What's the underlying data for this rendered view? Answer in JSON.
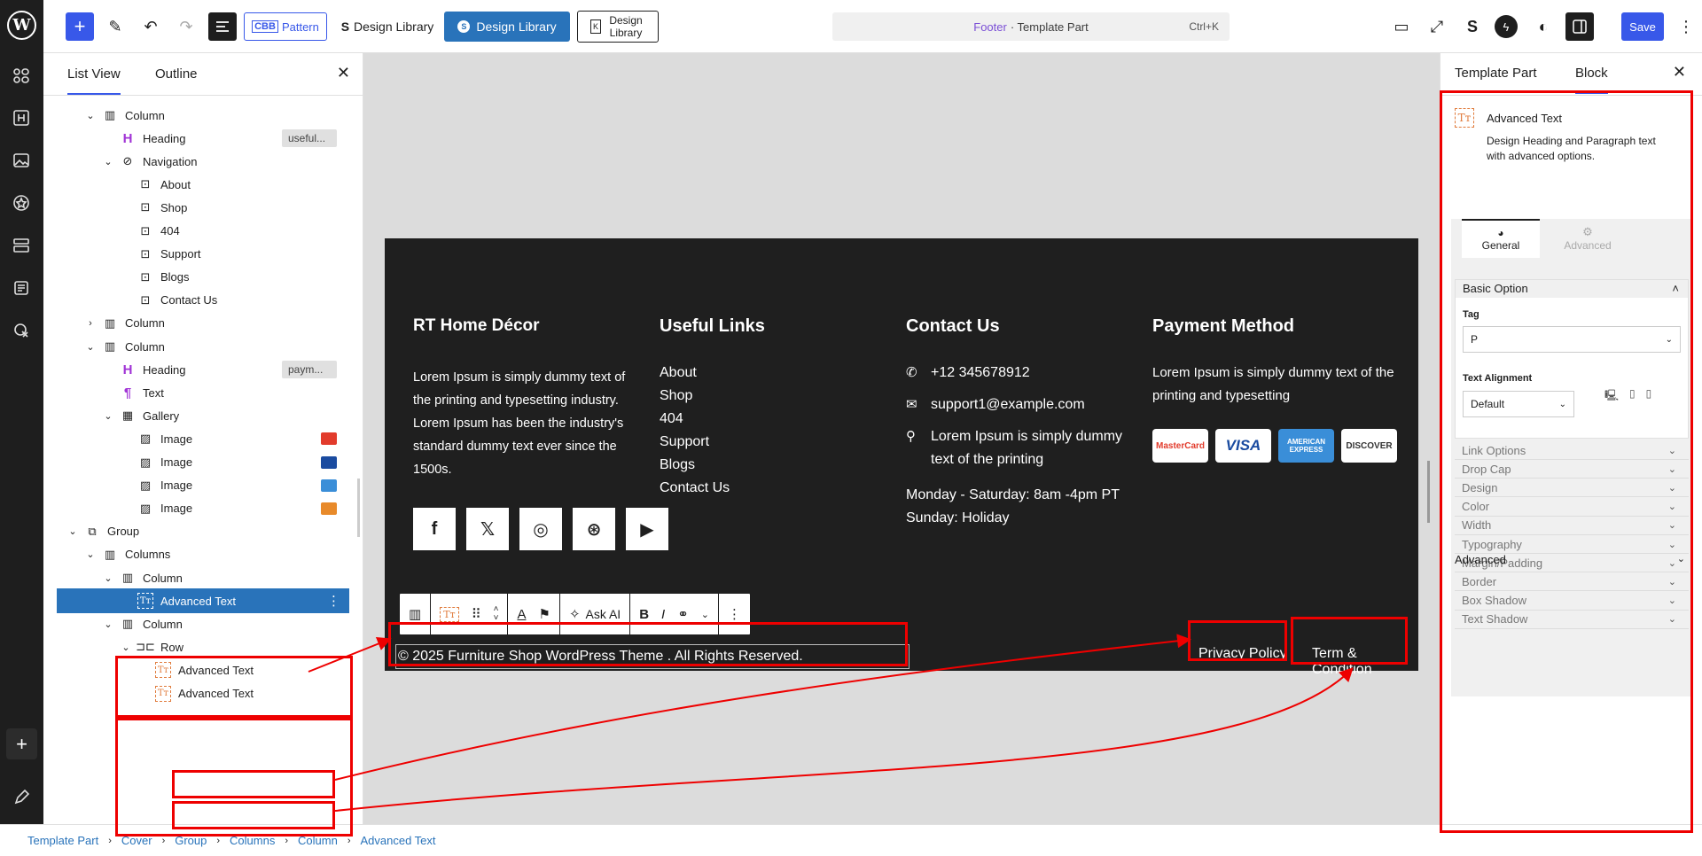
{
  "toolbar": {
    "pattern_label": "Pattern",
    "pattern_prefix": "CBB",
    "design_library_1": "Design Library",
    "design_library_2": "Design Library",
    "design_library_3": "Design Library",
    "doc_part": "Footer",
    "doc_type": "· Template Part",
    "shortcut": "Ctrl+K",
    "save": "Save"
  },
  "list_panel": {
    "tab_list": "List View",
    "tab_outline": "Outline",
    "rows": [
      {
        "label": "Column",
        "indent": 1,
        "chev": "⌄",
        "icon": "column"
      },
      {
        "label": "Heading",
        "indent": 2,
        "chev": "",
        "icon": "heading",
        "tag": "useful..."
      },
      {
        "label": "Navigation",
        "indent": 2,
        "chev": "⌄",
        "icon": "nav"
      },
      {
        "label": "About",
        "indent": 3,
        "chev": "",
        "icon": "link"
      },
      {
        "label": "Shop",
        "indent": 3,
        "chev": "",
        "icon": "link"
      },
      {
        "label": "404",
        "indent": 3,
        "chev": "",
        "icon": "link"
      },
      {
        "label": "Support",
        "indent": 3,
        "chev": "",
        "icon": "link"
      },
      {
        "label": "Blogs",
        "indent": 3,
        "chev": "",
        "icon": "link"
      },
      {
        "label": "Contact Us",
        "indent": 3,
        "chev": "",
        "icon": "link"
      },
      {
        "label": "Column",
        "indent": 1,
        "chev": "›",
        "icon": "column"
      },
      {
        "label": "Column",
        "indent": 1,
        "chev": "⌄",
        "icon": "column"
      },
      {
        "label": "Heading",
        "indent": 2,
        "chev": "",
        "icon": "heading",
        "tag": "paym..."
      },
      {
        "label": "Text",
        "indent": 2,
        "chev": "",
        "icon": "para"
      },
      {
        "label": "Gallery",
        "indent": 2,
        "chev": "⌄",
        "icon": "gallery"
      },
      {
        "label": "Image",
        "indent": 3,
        "chev": "",
        "icon": "image",
        "thumb": "#e23b2c"
      },
      {
        "label": "Image",
        "indent": 3,
        "chev": "",
        "icon": "image",
        "thumb": "#1a4ba0"
      },
      {
        "label": "Image",
        "indent": 3,
        "chev": "",
        "icon": "image",
        "thumb": "#3a8ed8"
      },
      {
        "label": "Image",
        "indent": 3,
        "chev": "",
        "icon": "image",
        "thumb": "#e88a2a"
      },
      {
        "label": "Group",
        "indent": 0,
        "chev": "⌄",
        "icon": "group"
      },
      {
        "label": "Columns",
        "indent": 1,
        "chev": "⌄",
        "icon": "columns"
      },
      {
        "label": "Column",
        "indent": 2,
        "chev": "⌄",
        "icon": "column"
      },
      {
        "label": "Advanced Text",
        "indent": 3,
        "chev": "",
        "icon": "tt",
        "selected": true
      },
      {
        "label": "Column",
        "indent": 2,
        "chev": "⌄",
        "icon": "column"
      },
      {
        "label": "Row",
        "indent": 3,
        "chev": "⌄",
        "icon": "row"
      },
      {
        "label": "Advanced Text",
        "indent": 4,
        "chev": "",
        "icon": "tt"
      },
      {
        "label": "Advanced Text",
        "indent": 4,
        "chev": "",
        "icon": "tt"
      }
    ]
  },
  "footer": {
    "col1_title": "RT Home Décor",
    "col1_text": "Lorem Ipsum is simply dummy text of the printing and typesetting industry. Lorem Ipsum has been the industry's standard dummy text ever since the 1500s.",
    "col2_title": "Useful Links",
    "links": [
      "About",
      "Shop",
      "404",
      "Support",
      "Blogs",
      "Contact Us"
    ],
    "col3_title": "Contact Us",
    "phone": "+12 345678912",
    "email": "support1@example.com",
    "address": "Lorem Ipsum is simply dummy text of the printing",
    "hours_1": "Monday - Saturday: 8am -4pm PT",
    "hours_2": "Sunday: Holiday",
    "col4_title": "Payment Method",
    "col4_text": "Lorem Ipsum is simply dummy text of the printing and typesetting",
    "cards": [
      {
        "label": "MasterCard",
        "bg": "#ffffff",
        "fg": "#e23b2c"
      },
      {
        "label": "VISA",
        "bg": "#ffffff",
        "fg": "#1a4ba0"
      },
      {
        "label": "AMERICAN EXPRESS",
        "bg": "#3a8ed8",
        "fg": "#ffffff"
      },
      {
        "label": "DISCOVER",
        "bg": "#ffffff",
        "fg": "#333333"
      }
    ],
    "copyright": "© 2025 Furniture Shop WordPress Theme . All Rights Reserved.",
    "privacy": "Privacy Policy",
    "terms": "Term & Condition",
    "ask_ai": "Ask AI"
  },
  "sidebar": {
    "tab_template": "Template Part",
    "tab_block": "Block",
    "block_title": "Advanced Text",
    "block_desc": "Design Heading and Paragraph text with advanced options.",
    "sub_general": "General",
    "sub_advanced": "Advanced",
    "basic_option": "Basic Option",
    "tag_label": "Tag",
    "tag_value": "P",
    "align_label": "Text Alignment",
    "align_value": "Default",
    "accordions": [
      "Link Options",
      "Drop Cap",
      "Design",
      "Color",
      "Width",
      "Typography",
      "Margin/Padding",
      "Border",
      "Box Shadow",
      "Text Shadow"
    ],
    "advanced_label": "Advanced"
  },
  "breadcrumb": [
    "Template Part",
    "Cover",
    "Group",
    "Columns",
    "Column",
    "Advanced Text"
  ],
  "colors": {
    "accent": "#3858e9",
    "selected": "#2973ba",
    "annotation": "#ee0000"
  }
}
